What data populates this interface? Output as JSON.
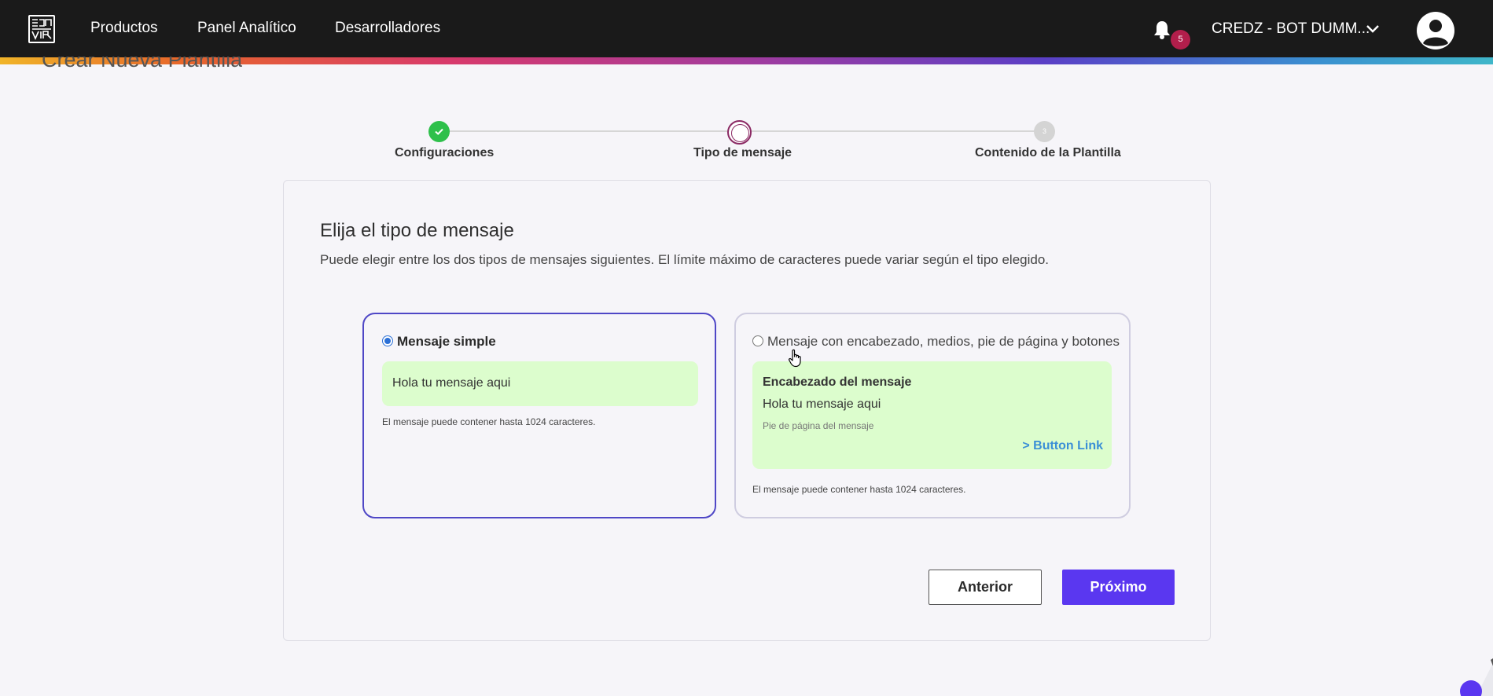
{
  "navbar": {
    "logo_icon": "zenvia-logo-icon",
    "links": [
      "Productos",
      "Panel Analítico",
      "Desarrolladores"
    ],
    "notifications_count": "5",
    "account_name": "CREDZ - BOT DUMM...",
    "colors": {
      "background": "#1a1a1a",
      "badge": "#b21e4b"
    }
  },
  "page": {
    "title": "Crear Nueva Plantilla"
  },
  "stepper": {
    "steps": [
      {
        "label": "Configuraciones",
        "state": "completed"
      },
      {
        "label": "Tipo de mensaje",
        "state": "current"
      },
      {
        "label": "Contenido de la Plantilla",
        "state": "pending",
        "number": "3"
      }
    ],
    "colors": {
      "completed": "#2ec04b",
      "current": "#8b2a64",
      "pending": "#d4d4d4"
    }
  },
  "card": {
    "title": "Elija el tipo de mensaje",
    "description": "Puede elegir entre los dos tipos de mensajes siguientes. El límite máximo de caracteres puede variar según el tipo elegido.",
    "options": [
      {
        "label": "Mensaje simple",
        "selected": true,
        "preview_text": "Hola tu mensaje aqui",
        "note": "El mensaje puede contener hasta 1024 caracteres."
      },
      {
        "label": "Mensaje con encabezado, medios, pie de página y botones",
        "selected": false,
        "preview_header": "Encabezado del mensaje",
        "preview_text": "Hola tu mensaje aqui",
        "preview_footer": "Pie de página del mensaje",
        "preview_button": "> Button Link",
        "note": "El mensaje puede contener hasta 1024 caracteres."
      }
    ],
    "buttons": {
      "previous": "Anterior",
      "next": "Próximo"
    },
    "colors": {
      "selected_border": "#4f47c6",
      "preview_bg": "#dcfdcd",
      "next_button": "#5a37f0"
    }
  }
}
